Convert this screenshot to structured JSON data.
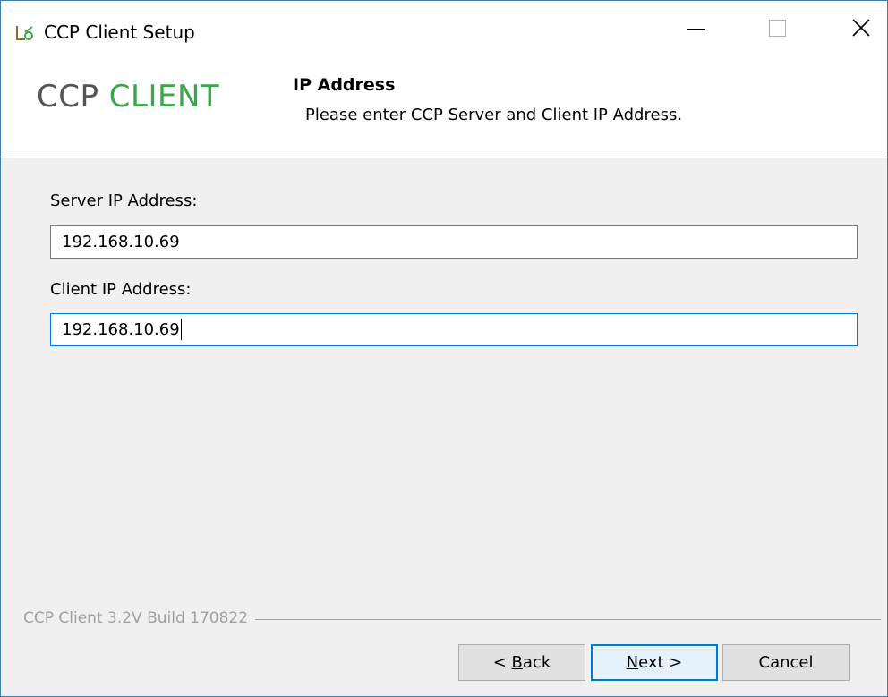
{
  "window": {
    "title": "CCP Client Setup",
    "controls": {
      "minimize": "minimize-icon",
      "maximize": "maximize-icon",
      "close": "close-icon"
    }
  },
  "header": {
    "logo_part1": "CCP",
    "logo_part2": "CLIENT",
    "title": "IP Address",
    "subtitle": "Please enter CCP Server and Client IP Address."
  },
  "form": {
    "server_label": "Server IP Address:",
    "server_value": "192.168.10.69",
    "client_label": "Client IP Address:",
    "client_value": "192.168.10.69"
  },
  "footer": {
    "build": "CCP Client 3.2V Build 170822"
  },
  "buttons": {
    "back_prefix": "< ",
    "back_mnemonic": "B",
    "back_rest": "ack",
    "next_mnemonic": "N",
    "next_rest": "ext >",
    "cancel": "Cancel"
  },
  "colors": {
    "brand_green": "#39a84a",
    "focus_blue": "#0078d7",
    "window_border": "#3c7fb1"
  }
}
